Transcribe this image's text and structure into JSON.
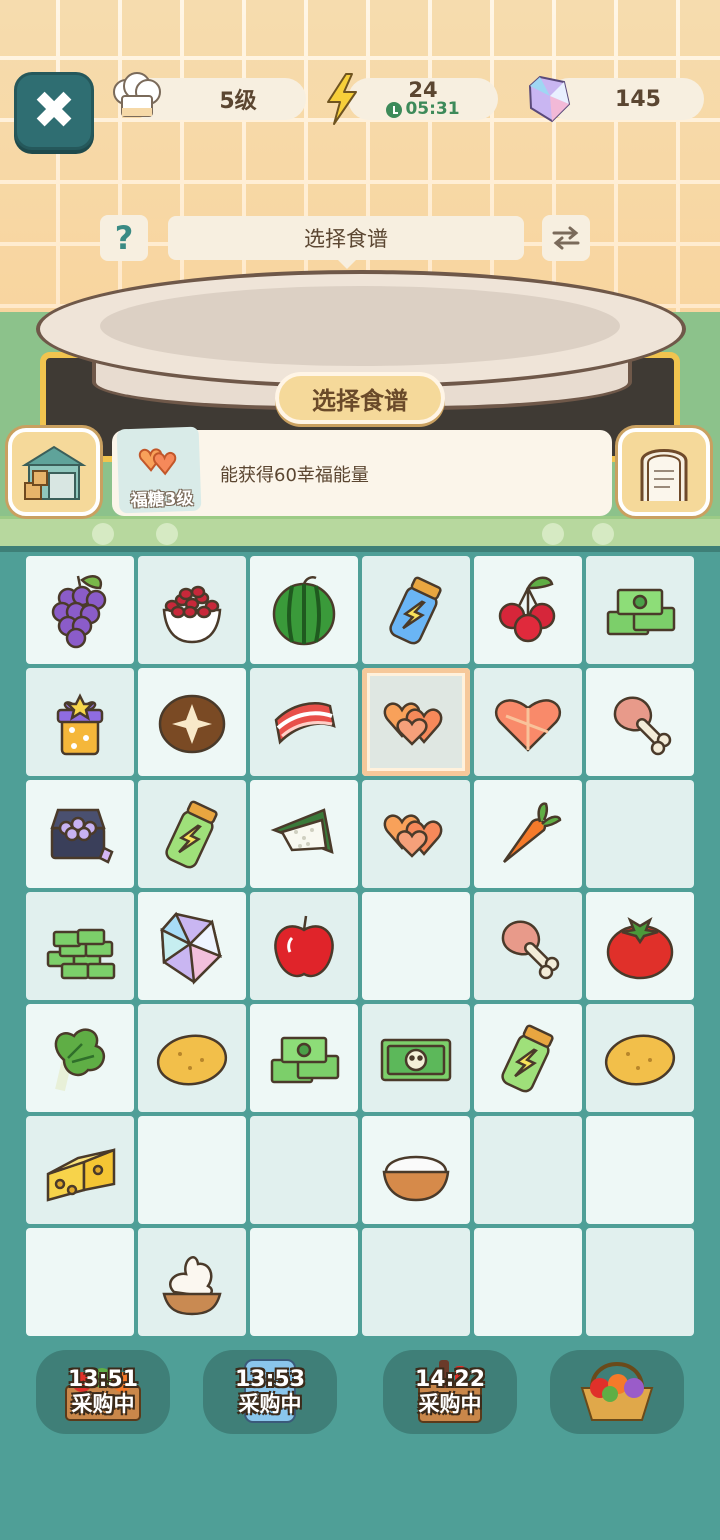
{
  "hud": {
    "chef_level": "5级",
    "energy_value": "24",
    "energy_timer": "05:31",
    "gems": "145"
  },
  "recipe": {
    "title": "选择食谱",
    "select_button": "选择食谱",
    "reward_item_label": "福糖3级",
    "reward_text": "能获得60幸福能量"
  },
  "board": {
    "rows": [
      [
        "grapes",
        "pomegranate-bowl",
        "watermelon",
        "blue-energy-jar",
        "cherries",
        "cash-stack"
      ],
      [
        "gift-box",
        "shiitake-mushroom",
        "bacon",
        "candy-hearts",
        "candy-heart",
        "chicken-leg"
      ],
      [
        "gem-chest",
        "green-energy-jar",
        "rice-dumpling",
        "candy-hearts",
        "carrot",
        ""
      ],
      [
        "cash-pile",
        "crystal-gem",
        "apple",
        "",
        "chicken-leg",
        "tomato"
      ],
      [
        "bok-choy",
        "potato",
        "cash-stack",
        "banknote",
        "green-energy-jar",
        "potato"
      ],
      [
        "cheese",
        "",
        "",
        "rice-bowl",
        "",
        ""
      ],
      [
        "",
        "cream-bowl",
        "",
        "",
        "",
        ""
      ]
    ],
    "selected_cell": [
      1,
      3
    ]
  },
  "shops": [
    {
      "time": "13:51",
      "status": "采购中",
      "icon": "vegetable-crate-icon"
    },
    {
      "time": "13:53",
      "status": "采购中",
      "icon": "fridge-icon"
    },
    {
      "time": "14:22",
      "status": "采购中",
      "icon": "drinks-box-icon"
    },
    {
      "time": "",
      "status": "",
      "icon": "fruit-basket-icon"
    }
  ],
  "colors": {
    "background": "#4f9f97",
    "cell": "#eef8f6",
    "accent_gold": "#f5d99a",
    "hud_pill": "#f7efe0",
    "close_button": "#2f6e72"
  }
}
